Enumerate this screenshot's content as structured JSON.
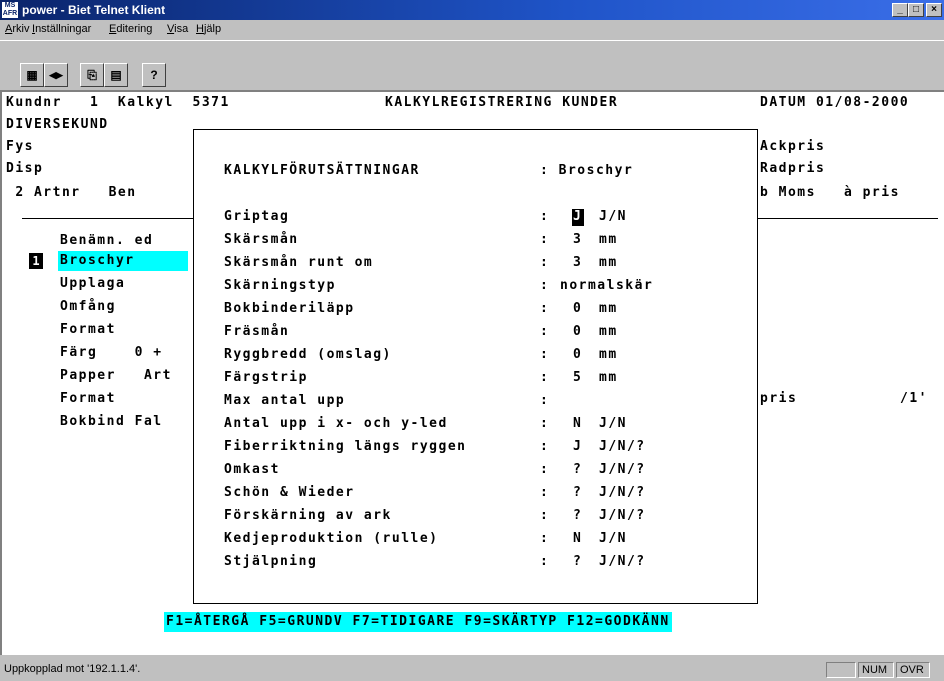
{
  "window": {
    "icon_text": [
      "MS",
      "AFR"
    ],
    "title": "power - Biet Telnet Klient",
    "controls": {
      "minimize": "_",
      "maximize": "□",
      "close": "×"
    }
  },
  "menu": [
    "Arkiv",
    "Inställningar",
    "Editering",
    "Visa",
    "Hjälp"
  ],
  "toolbar": {
    "buttons": [
      {
        "name": "connect",
        "glyph": "▦"
      },
      {
        "name": "disconnect",
        "glyph": "◀▶"
      },
      {
        "name": "copy",
        "glyph": "⎘"
      },
      {
        "name": "paste",
        "glyph": "▤"
      },
      {
        "name": "help",
        "glyph": "?"
      }
    ]
  },
  "terminal": {
    "header_left": "Kundnr   1  Kalkyl  5371",
    "header_title": "KALKYLREGISTRERING KUNDER",
    "header_date": "DATUM 01/08-2000",
    "line2": "DIVERSEKUND",
    "fys": "Fys",
    "disp": "Disp",
    "ackpris": "Ackpris",
    "radpris": "Radpris",
    "col_left": " 2 Artnr   Ben",
    "col_right": "b Moms   à pris",
    "left_items": [
      "Benämn. ed",
      "Broschyr",
      "Upplaga",
      "Omfång",
      "Format",
      "Färg    0 +",
      "Papper   Art",
      "Format",
      "Bokbind Fal"
    ],
    "selected_badge": "1",
    "right_pris": "pris",
    "right_val": "/1'"
  },
  "dialog": {
    "heading": "KALKYLFÖRUTSÄTTNINGAR",
    "heading_value": ": Broschyr",
    "rows": [
      {
        "label": "Griptag",
        "sep": ":",
        "value": "J",
        "suffix": "J/N"
      },
      {
        "label": "Skärsmån",
        "sep": ":",
        "value": "3",
        "suffix": "mm"
      },
      {
        "label": "Skärsmån runt om",
        "sep": ":",
        "value": "3",
        "suffix": "mm"
      },
      {
        "label": "Skärningstyp",
        "sep": ":",
        "value": "normalskär",
        "suffix": ""
      },
      {
        "label": "Bokbinderiläpp",
        "sep": ":",
        "value": "0",
        "suffix": "mm"
      },
      {
        "label": "Fräsmån",
        "sep": ":",
        "value": "0",
        "suffix": "mm"
      },
      {
        "label": "Ryggbredd (omslag)",
        "sep": ":",
        "value": "0",
        "suffix": "mm"
      },
      {
        "label": "Färgstrip",
        "sep": ":",
        "value": "5",
        "suffix": "mm"
      },
      {
        "label": "Max antal upp",
        "sep": ":",
        "value": "",
        "suffix": ""
      },
      {
        "label": "Antal upp i x- och y-led",
        "sep": ":",
        "value": "N",
        "suffix": "J/N"
      },
      {
        "label": "Fiberriktning längs ryggen",
        "sep": ":",
        "value": "J",
        "suffix": "J/N/?"
      },
      {
        "label": "Omkast",
        "sep": ":",
        "value": "?",
        "suffix": "J/N/?"
      },
      {
        "label": "Schön & Wieder",
        "sep": ":",
        "value": "?",
        "suffix": "J/N/?"
      },
      {
        "label": "Förskärning av ark",
        "sep": ":",
        "value": "?",
        "suffix": "J/N/?"
      },
      {
        "label": "Kedjeproduktion (rulle)",
        "sep": ":",
        "value": "N",
        "suffix": "J/N"
      },
      {
        "label": "Stjälpning",
        "sep": ":",
        "value": "?",
        "suffix": "J/N/?"
      }
    ]
  },
  "function_keys": "F1=ÅTERGÅ F5=GRUNDV F7=TIDIGARE F9=SKÄRTYP F12=GODKÄNN",
  "status": {
    "text": "Uppkopplad mot '192.1.1.4'.",
    "num": "NUM",
    "ovr": "OVR"
  }
}
